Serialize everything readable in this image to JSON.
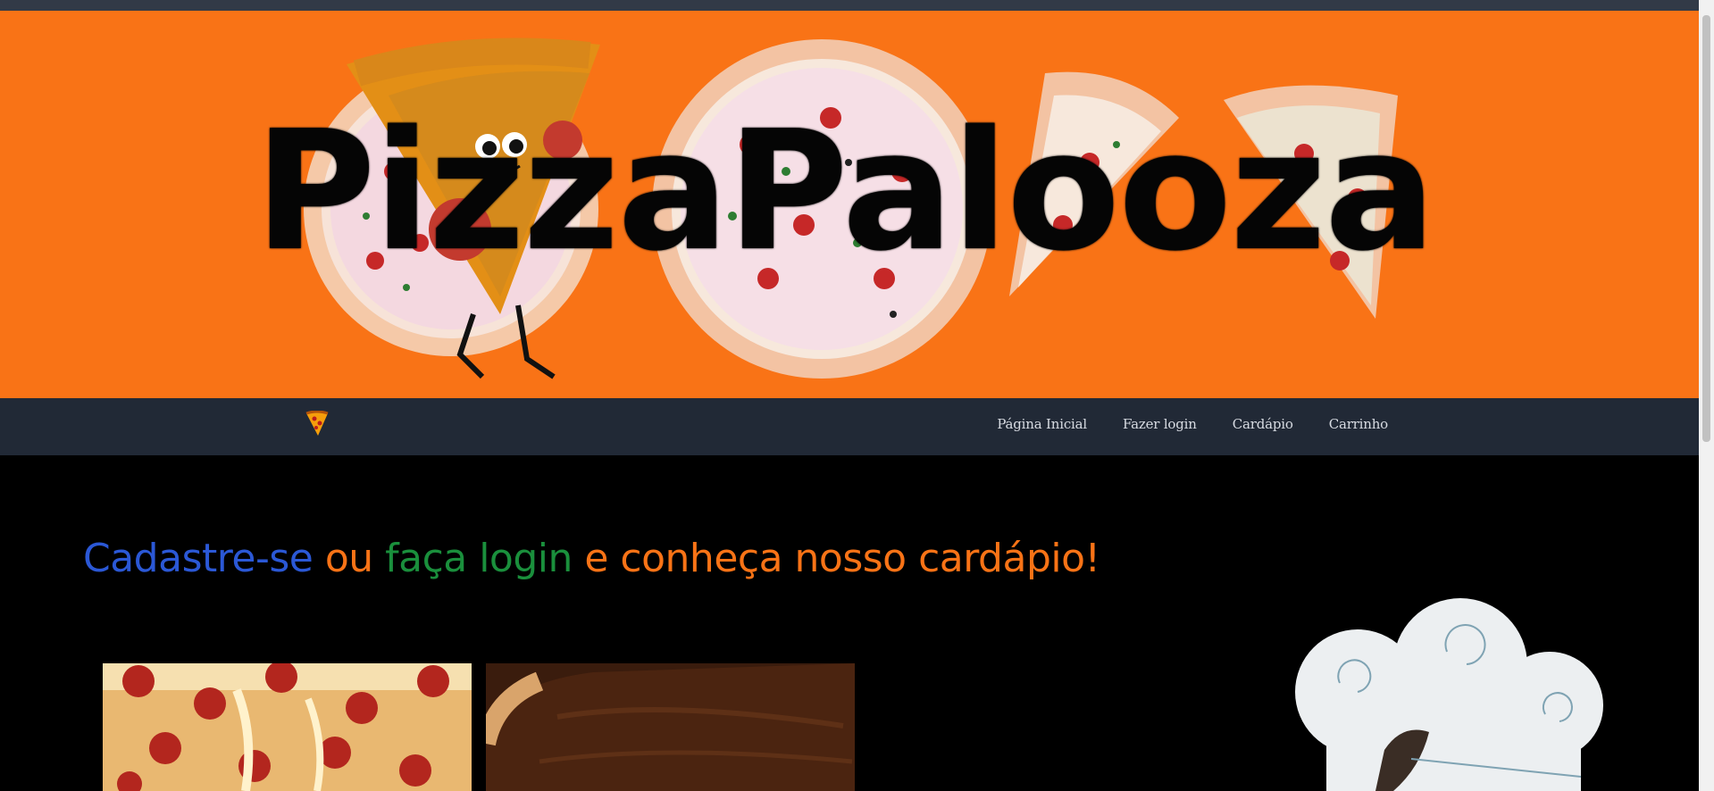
{
  "banner": {
    "brand": "PizzaPalooza"
  },
  "navbar": {
    "links": [
      "Página Inicial",
      "Fazer login",
      "Cardápio",
      "Carrinho"
    ]
  },
  "headline": {
    "part1": "Cadastre-se",
    "part2": " ou ",
    "part3": "faça login",
    "part4": " e conheça nosso cardápio!"
  },
  "colors": {
    "banner_bg": "#f97316",
    "navbar_bg": "#212936",
    "page_bg": "#000000",
    "blue": "#2b58d6",
    "orange": "#f97316",
    "green": "#1a8f3c"
  },
  "icons": [
    "pizza-slice-logo-icon",
    "chef-hat-icon"
  ]
}
